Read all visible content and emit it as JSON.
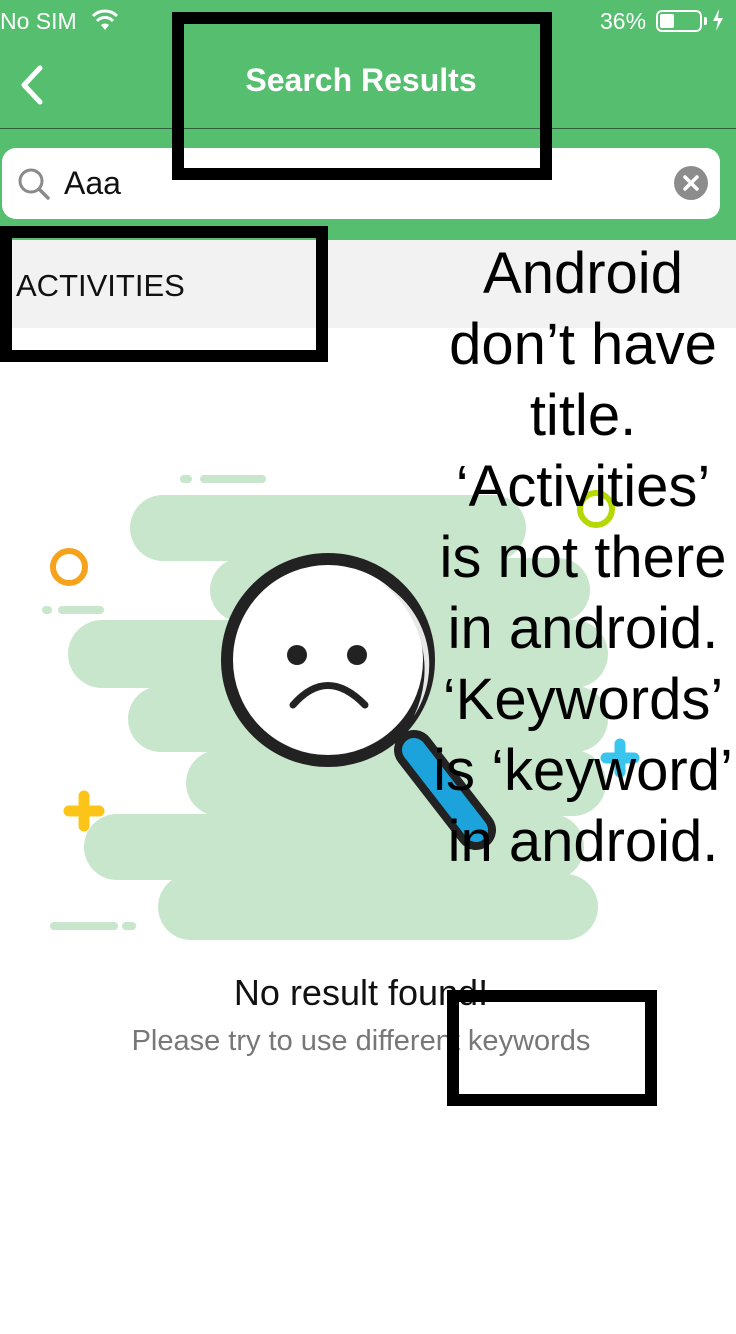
{
  "status_bar": {
    "carrier": "No SIM",
    "battery_percent": "36%",
    "battery_level": 0.36
  },
  "header": {
    "title": "Search Results",
    "background": "#55be6f"
  },
  "search": {
    "value": "Aaa"
  },
  "section": {
    "title": "ACTIVITIES"
  },
  "empty_state": {
    "title": "No result found!",
    "subtitle": "Please try to use different keywords"
  },
  "annotation": {
    "note": "Android don’t have title. ‘Activities’ is not there in android. ‘Keywords’ is ‘keyword’ in android."
  },
  "colors": {
    "accent": "#55be6f",
    "blob": "#c8e6cc",
    "handle": "#1da3dc",
    "orange_ring": "#f7a21b",
    "yellow_plus": "#fcc419",
    "cyan_plus": "#3ac5ef",
    "lime_ring": "#b4d800"
  }
}
